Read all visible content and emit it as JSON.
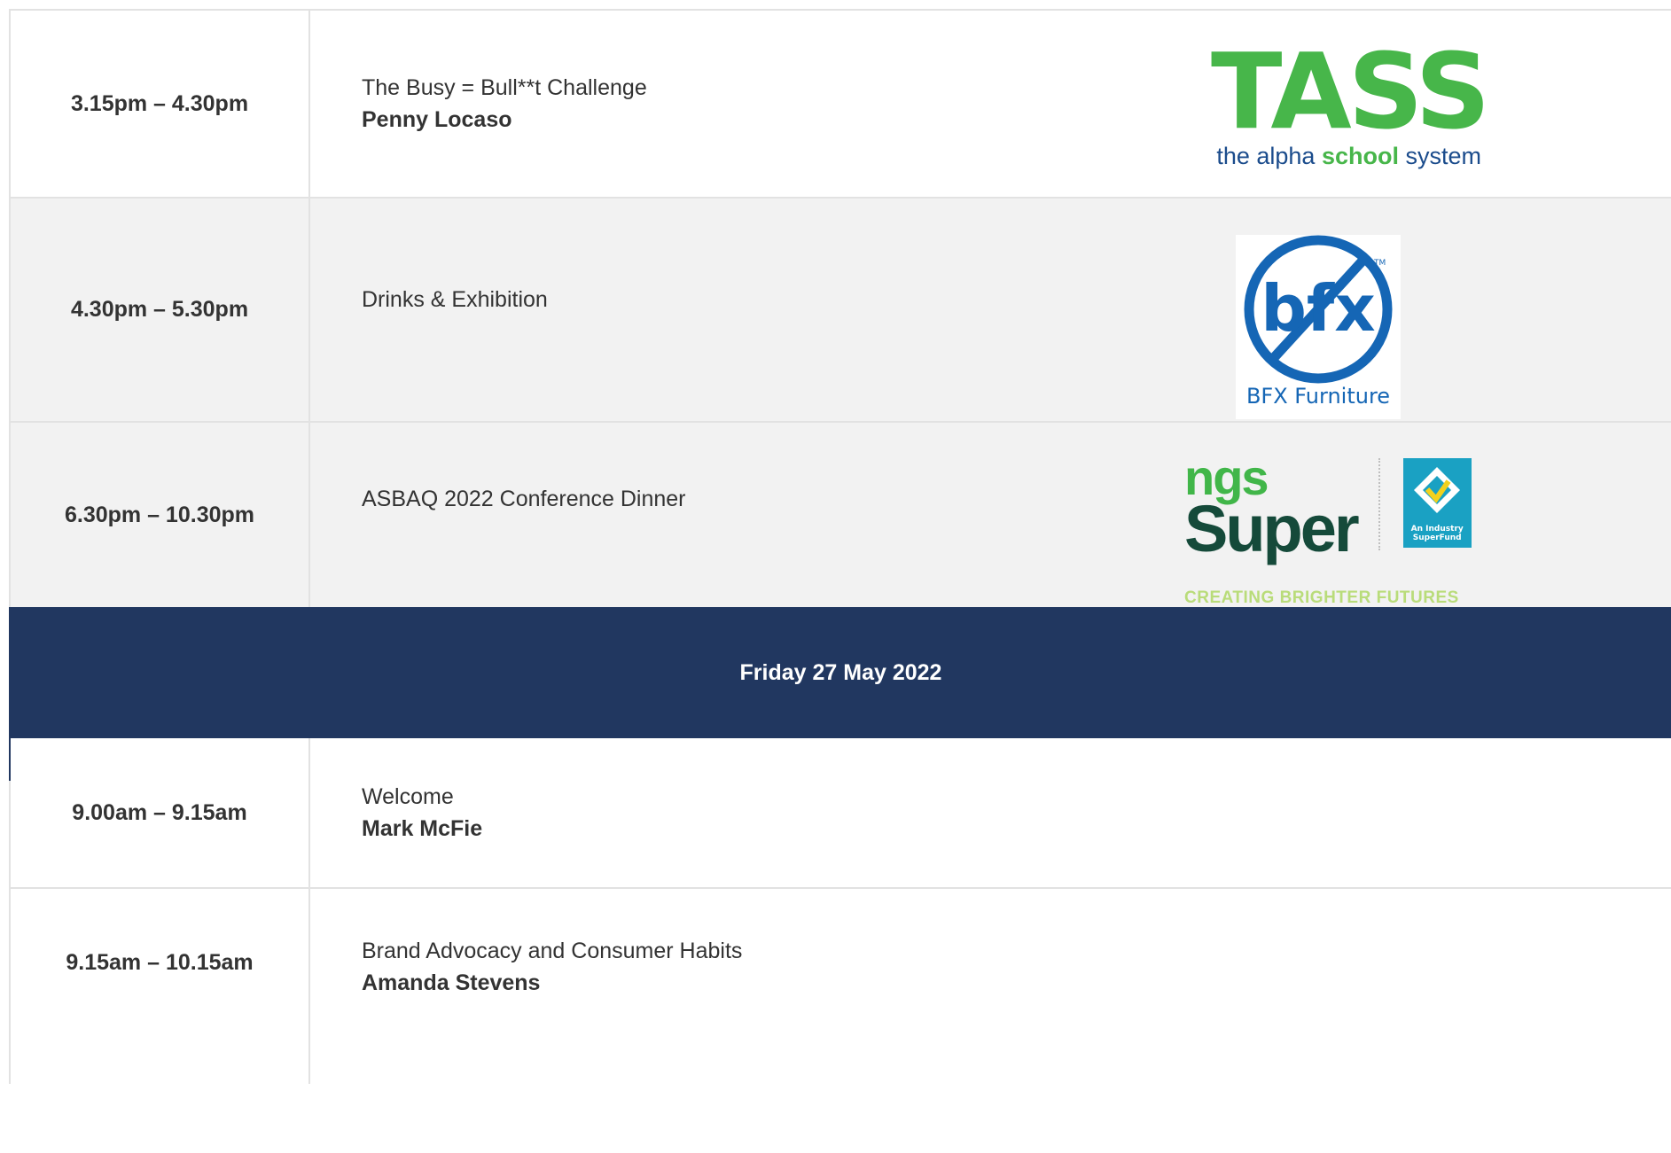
{
  "schedule": {
    "rows": [
      {
        "time": "3.15pm – 4.30pm",
        "title": "The Busy = Bull**t Challenge",
        "speaker": "Penny Locaso",
        "sponsor": {
          "mark": "TASS",
          "tagline_pre": "the alpha ",
          "tagline_mid": "school",
          "tagline_post": " system"
        }
      },
      {
        "time": "4.30pm – 5.30pm",
        "title": "Drinks & Exhibition",
        "sponsor": {
          "mark": "bfx",
          "tm": "TM",
          "label": "BFX Furniture"
        }
      },
      {
        "time": "6.30pm – 10.30pm",
        "title": "ASBAQ 2022 Conference Dinner",
        "sponsor": {
          "small": "ngs",
          "big": "Super",
          "badge_line1": "An Industry",
          "badge_line2": "SuperFund",
          "tagline": "CREATING BRIGHTER FUTURES"
        }
      }
    ],
    "day_banner": "Friday 27 May 2022",
    "day_rows": [
      {
        "time": "9.00am – 9.15am",
        "title": "Welcome",
        "speaker": "Mark McFie"
      },
      {
        "time": "9.15am – 10.15am",
        "title": "Brand Advocacy and Consumer Habits",
        "speaker": "Amanda Stevens"
      }
    ]
  },
  "colors": {
    "banner": "#213760",
    "row_grey": "#f2f2f2",
    "border": "#e2e2e2",
    "tass_green": "#47b64a",
    "tass_blue": "#1b4c8c",
    "bfx_blue": "#1566b5",
    "ngs_green": "#41b649",
    "ngs_dark": "#154a3a",
    "ngs_badge": "#1aa1c3",
    "ngs_tagline": "#b9dc7a"
  }
}
